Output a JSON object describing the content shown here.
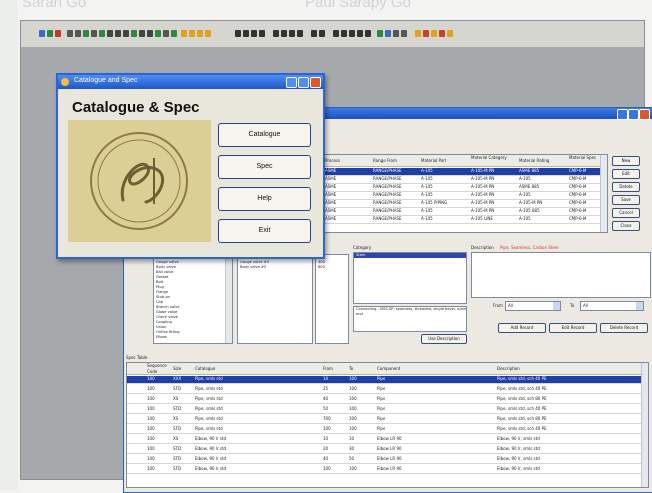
{
  "background_text": [
    "Sarah Go",
    "Paul Sarapy Go"
  ],
  "dialog": {
    "title": "Catalogue and Spec",
    "heading": "Catalogue & Spec",
    "buttons": [
      "Catalogue",
      "Spec",
      "Help",
      "Exit"
    ]
  },
  "main": {
    "upper_grid": {
      "headers": [
        "Process",
        "Range From",
        "Material Part",
        "Material Category",
        "Material Rating",
        "Material Spec"
      ],
      "rows": [
        [
          "ASME",
          "RANGE/PHASE",
          "A-105",
          "A-105-M PN",
          "ASME 885",
          "CMP-6-M"
        ],
        [
          "ASME",
          "RANGE/PHASE",
          "A-105",
          "A-105-M PN",
          "A-105",
          "CMP-6-M"
        ],
        [
          "ASME",
          "RANGE/PHASE",
          "A-105",
          "A-105-M PN",
          "ASME 885",
          "CMP-6-M"
        ],
        [
          "ASME",
          "RANGE/PHASE",
          "A-105",
          "A-105-M PN",
          "A-105",
          "CMP-6-M"
        ],
        [
          "ASME",
          "RANGE/PHASE",
          "A-105 PIPING",
          "A-105-M PN",
          "A-105-M PN",
          "CMP-6-M"
        ],
        [
          "ASME",
          "RANGE/PHASE",
          "A-105",
          "A-105-M PN",
          "A-105 885",
          "CMP-6-M"
        ],
        [
          "ASME",
          "RANGE/PHASE",
          "A-105",
          "A-105 LINE",
          "A-105",
          "CMP-6-M"
        ]
      ],
      "side_buttons": [
        "New",
        "Edit",
        "Delete",
        "Save",
        "Cancel",
        "Close"
      ]
    },
    "left_list": [
      "Single valve",
      "Gauge valve",
      "Body valve",
      "Ball valve",
      "Gasket",
      "Bolt",
      "Plug",
      "Flange",
      "Stub-on",
      "Cap",
      "Branch valve",
      "Globe valve",
      "Check valve",
      "Coupling",
      "Union",
      "Orifice fitting",
      "Elbow"
    ],
    "mid_list": [
      "Single valve #5",
      "Gauge valve #5",
      "Body valve #5"
    ],
    "num_list": [
      "150",
      "300",
      "600"
    ],
    "category_label": "Category",
    "category_item": "Stem",
    "description_label": "Description",
    "description_hint": "Pipe, Seamless, Carbon Steel",
    "desc_text": "Connecting - MSS-SP, seamless, threaded, single bevel, plain end",
    "from_label": "From",
    "to_label": "To",
    "from_value": "All",
    "to_value": "All",
    "buttons": [
      "Add Record",
      "Edit Record",
      "Delete Record"
    ],
    "more_button": "Use Description",
    "lower_grid": {
      "title": "Spec Table",
      "headers": [
        "Sequence Code",
        "Size",
        "Catalogue",
        "From",
        "To",
        "Component",
        "Description"
      ],
      "rows": [
        [
          "100",
          "XXX",
          "Pipe, smls std",
          "10",
          "100",
          "Pipe",
          "Pipe, smls std, sch 40 PE"
        ],
        [
          "100",
          "STD",
          "Pipe, smls std",
          "25",
          "100",
          "Pipe",
          "Pipe, smls std, sch 40 PE"
        ],
        [
          "100",
          "XS",
          "Pipe, smls std",
          "40",
          "100",
          "Pipe",
          "Pipe, smls std, sch 80 PE"
        ],
        [
          "100",
          "STD",
          "Pipe, smls std",
          "50",
          "100",
          "Pipe",
          "Pipe, smls std, sch 40 PE"
        ],
        [
          "100",
          "XS",
          "Pipe, smls std",
          "700",
          "100",
          "Pipe",
          "Pipe, smls std, sch 80 PE"
        ],
        [
          "100",
          "STD",
          "Pipe, smls std",
          "100",
          "100",
          "Pipe",
          "Pipe, smls std, sch 40 PE"
        ],
        [
          "100",
          "XS",
          "Elbow, 90 lr std",
          "10",
          "10",
          "Elbow LR 90",
          "Elbow, 90 lr, smls std"
        ],
        [
          "100",
          "STD",
          "Elbow, 90 lr std",
          "20",
          "30",
          "Elbow LR 90",
          "Elbow, 90 lr, smls std"
        ],
        [
          "100",
          "STD",
          "Elbow, 90 lr std",
          "40",
          "50",
          "Elbow LR 90",
          "Elbow, 90 lr, smls std"
        ],
        [
          "100",
          "STD",
          "Elbow, 90 lr std",
          "100",
          "100",
          "Elbow LR 90",
          "Elbow, 90 lr, smls std"
        ]
      ]
    }
  }
}
